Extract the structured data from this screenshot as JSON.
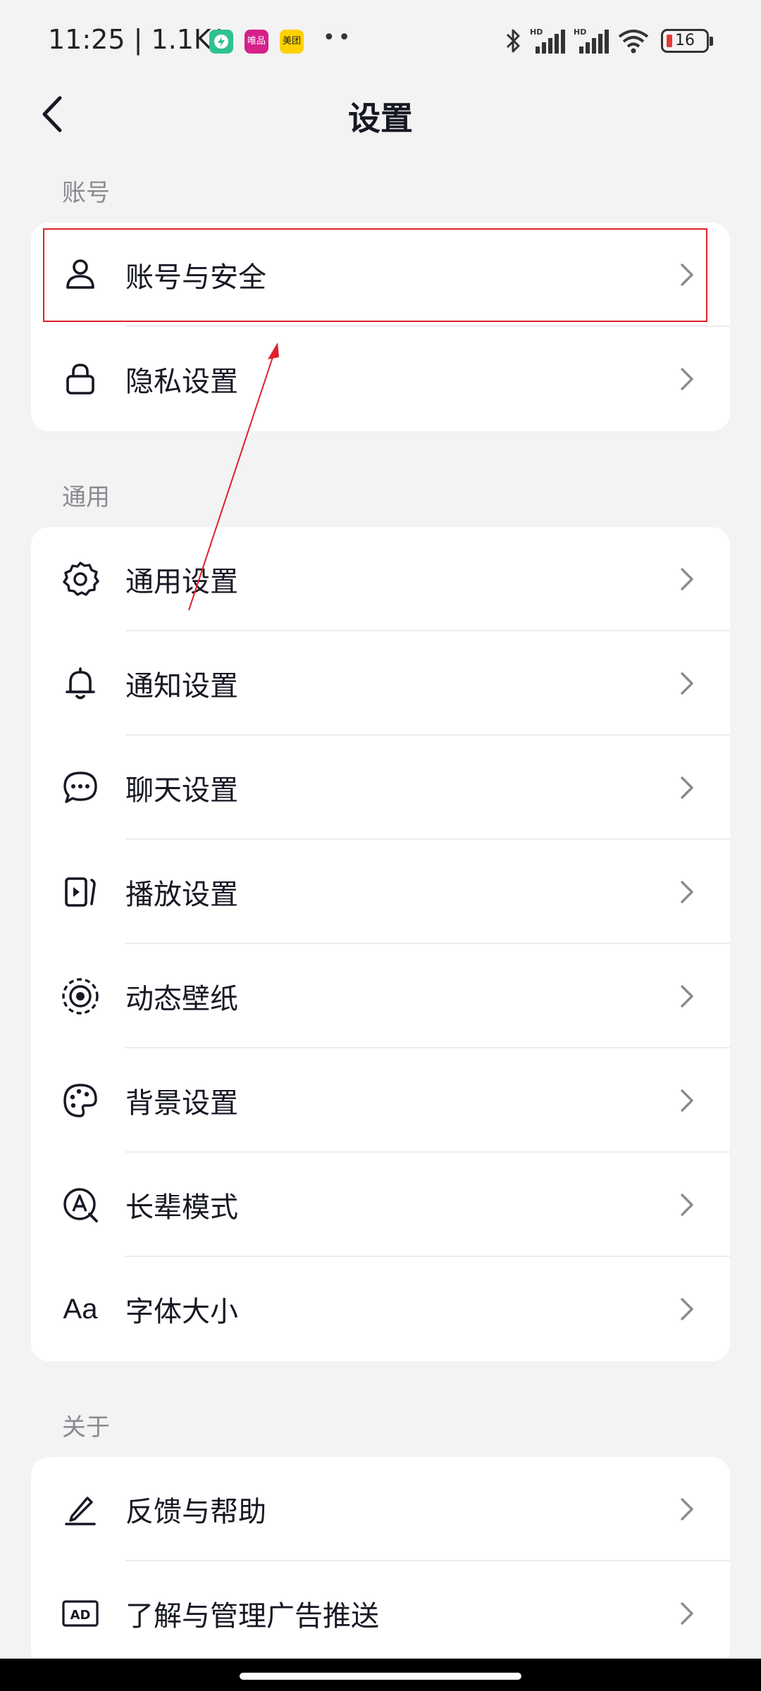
{
  "status_bar": {
    "time_speed": "11:25 | 1.1K/s",
    "app_badges": [
      "唯品会",
      "美团"
    ],
    "battery_level": "16"
  },
  "nav": {
    "title": "设置"
  },
  "sections": {
    "account": {
      "header": "账号",
      "items": [
        {
          "label": "账号与安全",
          "icon": "user-icon"
        },
        {
          "label": "隐私设置",
          "icon": "lock-icon"
        }
      ]
    },
    "general": {
      "header": "通用",
      "items": [
        {
          "label": "通用设置",
          "icon": "gear-icon"
        },
        {
          "label": "通知设置",
          "icon": "bell-icon"
        },
        {
          "label": "聊天设置",
          "icon": "chat-bubble-icon"
        },
        {
          "label": "播放设置",
          "icon": "play-icon"
        },
        {
          "label": "动态壁纸",
          "icon": "target-icon"
        },
        {
          "label": "背景设置",
          "icon": "palette-icon"
        },
        {
          "label": "长辈模式",
          "icon": "elder-mode-icon"
        },
        {
          "label": "字体大小",
          "icon": "font-size-icon",
          "icon_text": "Aa"
        }
      ]
    },
    "about": {
      "header": "关于",
      "items": [
        {
          "label": "反馈与帮助",
          "icon": "pen-icon"
        },
        {
          "label": "了解与管理广告推送",
          "icon": "ad-icon",
          "icon_text": "AD"
        }
      ]
    }
  },
  "colors": {
    "background": "#f3f3f3",
    "card": "#ffffff",
    "annotation": "#e0202a"
  }
}
